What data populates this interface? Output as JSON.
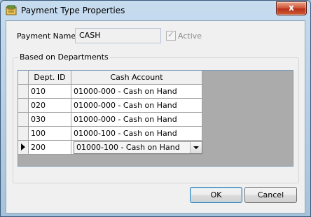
{
  "window": {
    "title": "Payment Type Properties",
    "close_glyph": "x"
  },
  "payment_name": {
    "label": "Payment Name:",
    "value": "CASH"
  },
  "active": {
    "label": "Active",
    "checked": true
  },
  "group": {
    "label": "Based on Departments"
  },
  "grid": {
    "headers": [
      "Dept. ID",
      "Cash Account"
    ],
    "rows": [
      {
        "dept": "010",
        "account": "01000-000 - Cash on Hand"
      },
      {
        "dept": "020",
        "account": "01000-000 - Cash on Hand"
      },
      {
        "dept": "030",
        "account": "01000-000 - Cash on Hand"
      },
      {
        "dept": "100",
        "account": "01000-100 - Cash on Hand"
      },
      {
        "dept": "200",
        "account": "01000-100 - Cash on Hand",
        "current": true
      }
    ]
  },
  "buttons": {
    "ok": "OK",
    "cancel": "Cancel"
  },
  "colors": {
    "title_close": "#c0391d",
    "ok_focus": "#3c7fb1"
  }
}
